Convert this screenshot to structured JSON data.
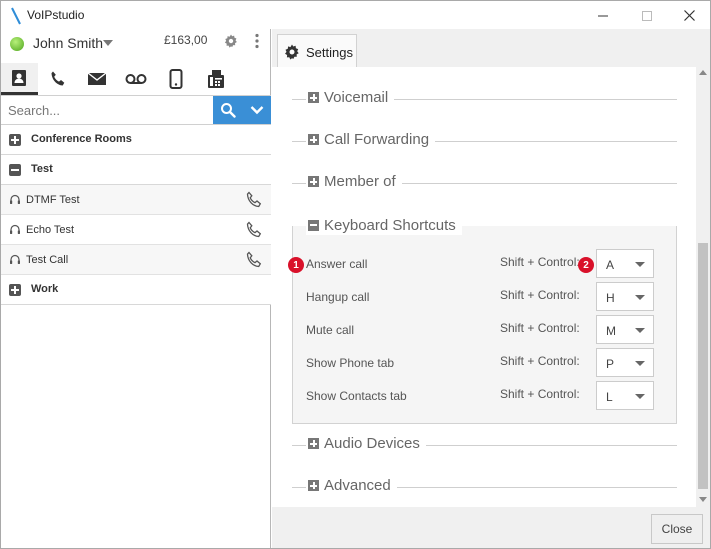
{
  "window": {
    "title": "VoIPstudio",
    "minimize": "—",
    "maximize": "☐",
    "close": "✕"
  },
  "user": {
    "name": "John Smith",
    "balance": "£163,00",
    "status_color": "#4ea51c"
  },
  "nav_tabs": [
    {
      "icon": "contacts-icon",
      "active": true
    },
    {
      "icon": "phone-icon",
      "active": false
    },
    {
      "icon": "mail-icon",
      "active": false
    },
    {
      "icon": "voicemail-icon",
      "active": false
    },
    {
      "icon": "mobile-icon",
      "active": false
    },
    {
      "icon": "fax-icon",
      "active": false
    }
  ],
  "search": {
    "placeholder": "Search...",
    "accent": "#3a8fd6"
  },
  "contacts": {
    "groups": [
      {
        "label": "Conference Rooms",
        "expanded": false
      },
      {
        "label": "Test",
        "expanded": true,
        "items": [
          "DTMF Test",
          "Echo Test",
          "Test Call"
        ]
      },
      {
        "label": "Work",
        "expanded": false
      }
    ]
  },
  "settings": {
    "tab_label": "Settings",
    "sections": {
      "voicemail": "Voicemail",
      "call_forwarding": "Call Forwarding",
      "member_of": "Member of",
      "keyboard_shortcuts": "Keyboard Shortcuts",
      "audio_devices": "Audio Devices",
      "advanced": "Advanced"
    },
    "shortcuts": [
      {
        "label": "Answer call",
        "modifier": "Shift + Control:",
        "key": "A"
      },
      {
        "label": "Hangup call",
        "modifier": "Shift + Control:",
        "key": "H"
      },
      {
        "label": "Mute call",
        "modifier": "Shift + Control:",
        "key": "M"
      },
      {
        "label": "Show Phone tab",
        "modifier": "Shift + Control:",
        "key": "P"
      },
      {
        "label": "Show Contacts tab",
        "modifier": "Shift + Control:",
        "key": "L"
      }
    ],
    "markers": [
      "1",
      "2"
    ],
    "close_label": "Close"
  }
}
